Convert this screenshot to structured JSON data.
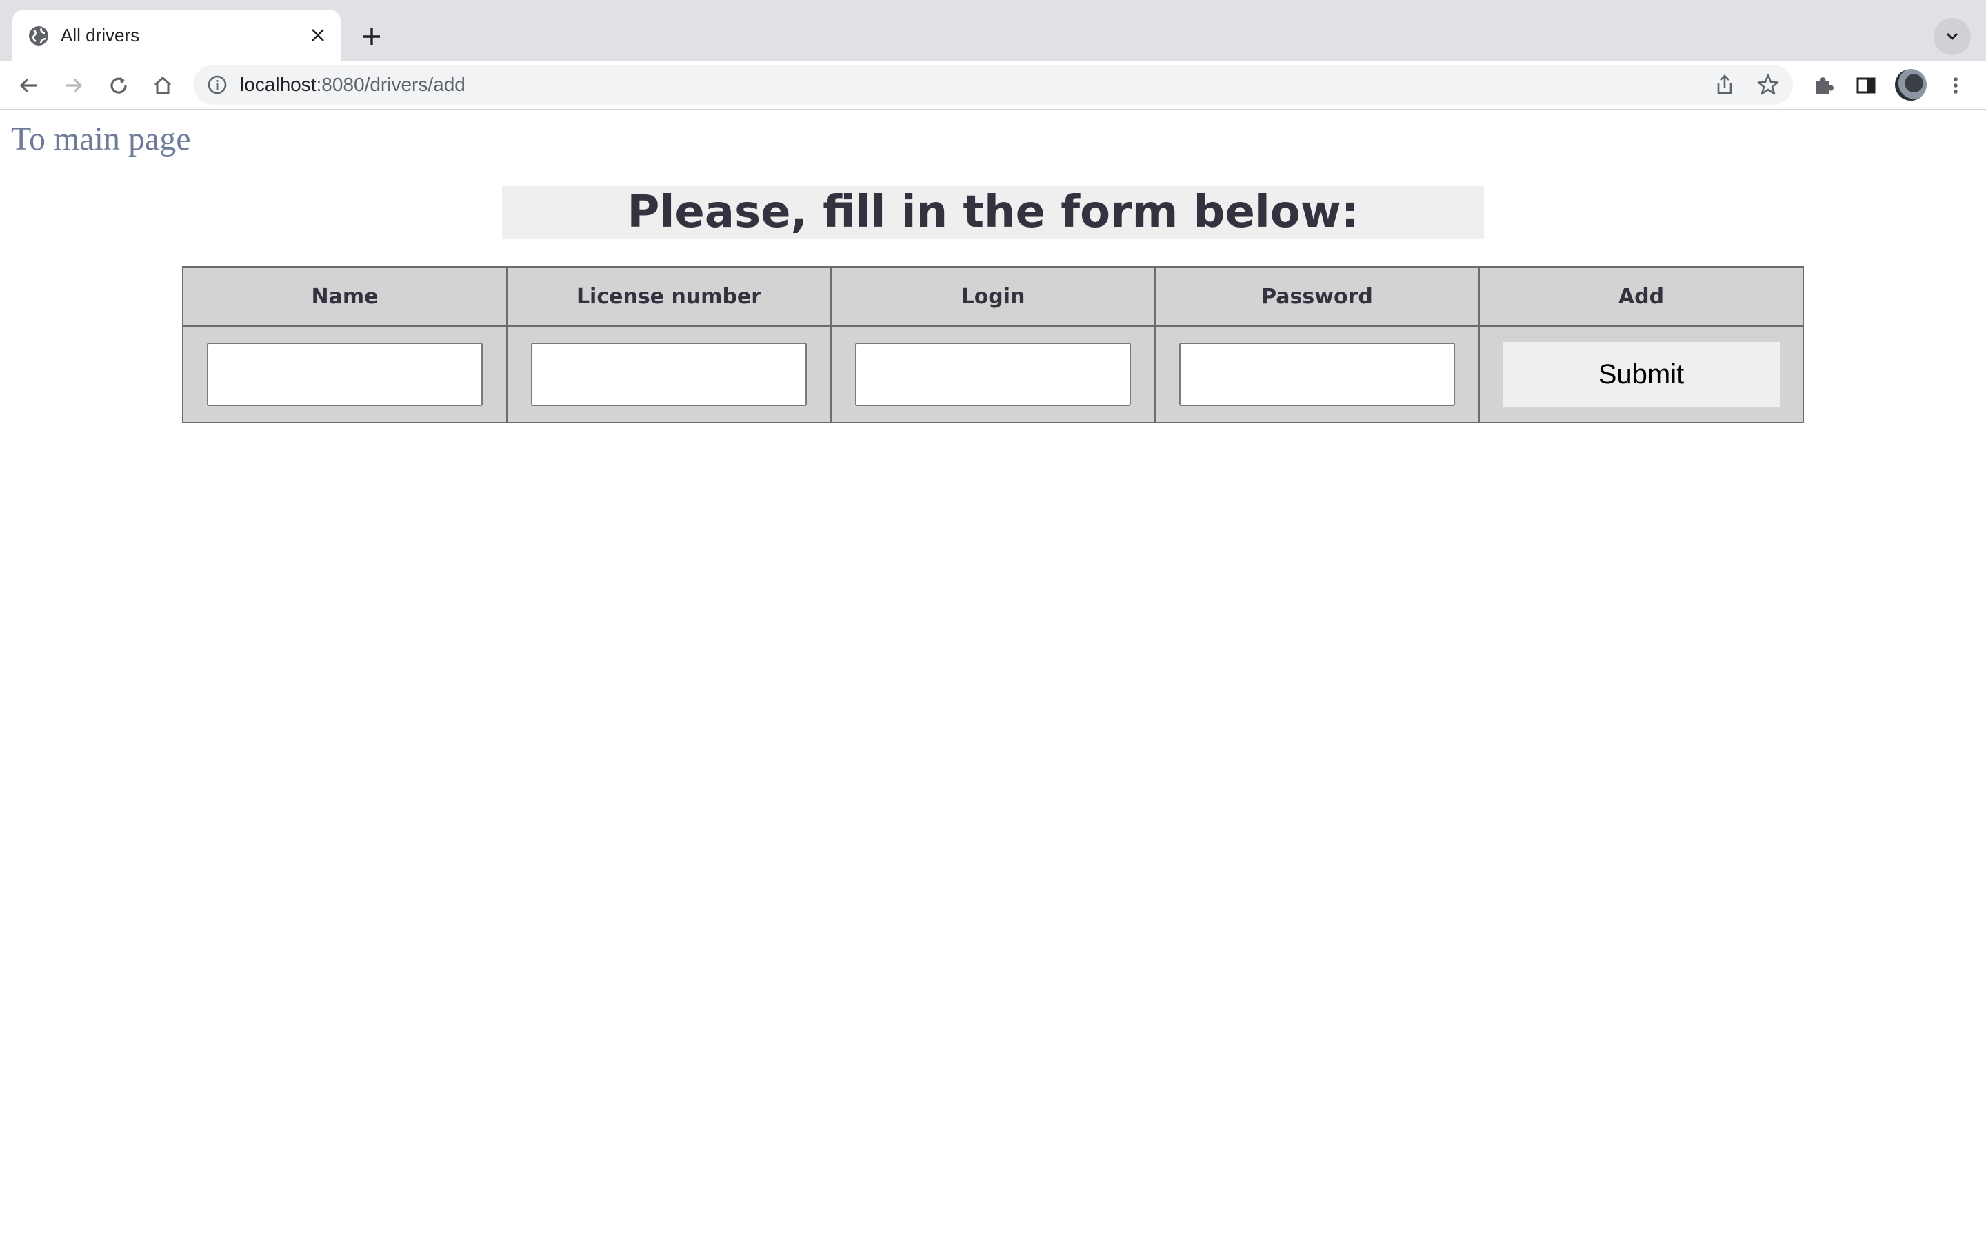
{
  "browser": {
    "tab_title": "All drivers",
    "url_host": "localhost",
    "url_path": ":8080/drivers/add"
  },
  "page": {
    "main_link": "To main page",
    "heading": "Please, fill in the form below:",
    "columns": [
      "Name",
      "License number",
      "Login",
      "Password",
      "Add"
    ],
    "fields": {
      "name": "",
      "license_number": "",
      "login": "",
      "password": ""
    },
    "submit_label": "Submit"
  },
  "colors": {
    "link": "#6f7c99",
    "heading_bg": "#efefef",
    "table_bg": "#d3d3d3",
    "text": "#33333f"
  }
}
